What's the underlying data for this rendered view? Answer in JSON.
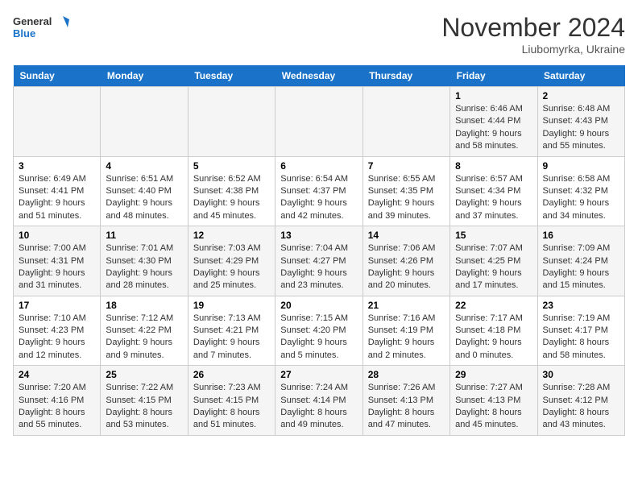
{
  "logo": {
    "line1": "General",
    "line2": "Blue"
  },
  "header": {
    "month": "November 2024",
    "location": "Liubomyrka, Ukraine"
  },
  "weekdays": [
    "Sunday",
    "Monday",
    "Tuesday",
    "Wednesday",
    "Thursday",
    "Friday",
    "Saturday"
  ],
  "weeks": [
    [
      {
        "day": "",
        "info": ""
      },
      {
        "day": "",
        "info": ""
      },
      {
        "day": "",
        "info": ""
      },
      {
        "day": "",
        "info": ""
      },
      {
        "day": "",
        "info": ""
      },
      {
        "day": "1",
        "info": "Sunrise: 6:46 AM\nSunset: 4:44 PM\nDaylight: 9 hours and 58 minutes."
      },
      {
        "day": "2",
        "info": "Sunrise: 6:48 AM\nSunset: 4:43 PM\nDaylight: 9 hours and 55 minutes."
      }
    ],
    [
      {
        "day": "3",
        "info": "Sunrise: 6:49 AM\nSunset: 4:41 PM\nDaylight: 9 hours and 51 minutes."
      },
      {
        "day": "4",
        "info": "Sunrise: 6:51 AM\nSunset: 4:40 PM\nDaylight: 9 hours and 48 minutes."
      },
      {
        "day": "5",
        "info": "Sunrise: 6:52 AM\nSunset: 4:38 PM\nDaylight: 9 hours and 45 minutes."
      },
      {
        "day": "6",
        "info": "Sunrise: 6:54 AM\nSunset: 4:37 PM\nDaylight: 9 hours and 42 minutes."
      },
      {
        "day": "7",
        "info": "Sunrise: 6:55 AM\nSunset: 4:35 PM\nDaylight: 9 hours and 39 minutes."
      },
      {
        "day": "8",
        "info": "Sunrise: 6:57 AM\nSunset: 4:34 PM\nDaylight: 9 hours and 37 minutes."
      },
      {
        "day": "9",
        "info": "Sunrise: 6:58 AM\nSunset: 4:32 PM\nDaylight: 9 hours and 34 minutes."
      }
    ],
    [
      {
        "day": "10",
        "info": "Sunrise: 7:00 AM\nSunset: 4:31 PM\nDaylight: 9 hours and 31 minutes."
      },
      {
        "day": "11",
        "info": "Sunrise: 7:01 AM\nSunset: 4:30 PM\nDaylight: 9 hours and 28 minutes."
      },
      {
        "day": "12",
        "info": "Sunrise: 7:03 AM\nSunset: 4:29 PM\nDaylight: 9 hours and 25 minutes."
      },
      {
        "day": "13",
        "info": "Sunrise: 7:04 AM\nSunset: 4:27 PM\nDaylight: 9 hours and 23 minutes."
      },
      {
        "day": "14",
        "info": "Sunrise: 7:06 AM\nSunset: 4:26 PM\nDaylight: 9 hours and 20 minutes."
      },
      {
        "day": "15",
        "info": "Sunrise: 7:07 AM\nSunset: 4:25 PM\nDaylight: 9 hours and 17 minutes."
      },
      {
        "day": "16",
        "info": "Sunrise: 7:09 AM\nSunset: 4:24 PM\nDaylight: 9 hours and 15 minutes."
      }
    ],
    [
      {
        "day": "17",
        "info": "Sunrise: 7:10 AM\nSunset: 4:23 PM\nDaylight: 9 hours and 12 minutes."
      },
      {
        "day": "18",
        "info": "Sunrise: 7:12 AM\nSunset: 4:22 PM\nDaylight: 9 hours and 9 minutes."
      },
      {
        "day": "19",
        "info": "Sunrise: 7:13 AM\nSunset: 4:21 PM\nDaylight: 9 hours and 7 minutes."
      },
      {
        "day": "20",
        "info": "Sunrise: 7:15 AM\nSunset: 4:20 PM\nDaylight: 9 hours and 5 minutes."
      },
      {
        "day": "21",
        "info": "Sunrise: 7:16 AM\nSunset: 4:19 PM\nDaylight: 9 hours and 2 minutes."
      },
      {
        "day": "22",
        "info": "Sunrise: 7:17 AM\nSunset: 4:18 PM\nDaylight: 9 hours and 0 minutes."
      },
      {
        "day": "23",
        "info": "Sunrise: 7:19 AM\nSunset: 4:17 PM\nDaylight: 8 hours and 58 minutes."
      }
    ],
    [
      {
        "day": "24",
        "info": "Sunrise: 7:20 AM\nSunset: 4:16 PM\nDaylight: 8 hours and 55 minutes."
      },
      {
        "day": "25",
        "info": "Sunrise: 7:22 AM\nSunset: 4:15 PM\nDaylight: 8 hours and 53 minutes."
      },
      {
        "day": "26",
        "info": "Sunrise: 7:23 AM\nSunset: 4:15 PM\nDaylight: 8 hours and 51 minutes."
      },
      {
        "day": "27",
        "info": "Sunrise: 7:24 AM\nSunset: 4:14 PM\nDaylight: 8 hours and 49 minutes."
      },
      {
        "day": "28",
        "info": "Sunrise: 7:26 AM\nSunset: 4:13 PM\nDaylight: 8 hours and 47 minutes."
      },
      {
        "day": "29",
        "info": "Sunrise: 7:27 AM\nSunset: 4:13 PM\nDaylight: 8 hours and 45 minutes."
      },
      {
        "day": "30",
        "info": "Sunrise: 7:28 AM\nSunset: 4:12 PM\nDaylight: 8 hours and 43 minutes."
      }
    ]
  ]
}
